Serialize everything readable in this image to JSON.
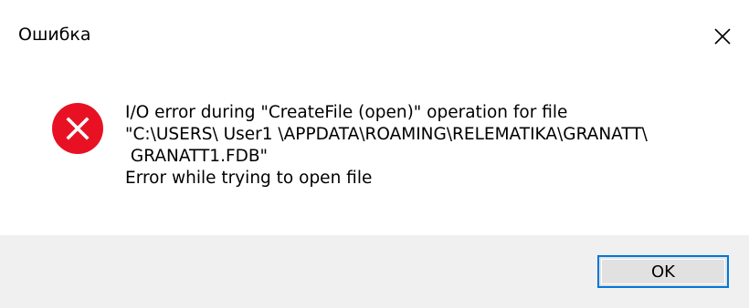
{
  "window": {
    "title": "Ошибка",
    "close_icon": "close-icon"
  },
  "message": {
    "icon": "error-icon",
    "lines": [
      "I/O error during \"CreateFile (open)\" operation for file",
      "\"C:\\USERS\\ User1 \\APPDATA\\ROAMING\\RELEMATIKA\\GRANATT\\",
      " GRANATT1.FDB\"",
      "Error while trying to open file"
    ]
  },
  "buttons": {
    "ok_label": "OK"
  },
  "colors": {
    "error_red": "#e81123",
    "accent": "#0078d7",
    "footer_bg": "#f0f0f0"
  }
}
